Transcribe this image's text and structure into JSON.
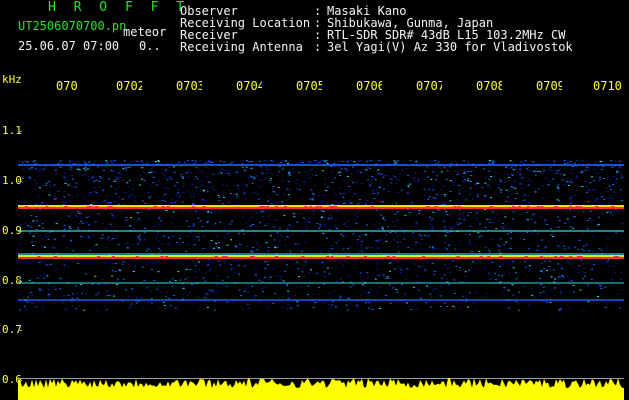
{
  "header": {
    "brand": "H R O F F T",
    "filename": "UT2506070700.pn",
    "meteor_label": "meteor",
    "datetime": "25.06.07 07:00",
    "counter": "0.."
  },
  "metadata": [
    {
      "label": "Observer",
      "value": "Masaki Kano"
    },
    {
      "label": "Receiving Location",
      "value": "Shibukawa, Gunma, Japan"
    },
    {
      "label": "Receiver",
      "value": "RTL-SDR SDR# 43dB L15 103.2MHz CW"
    },
    {
      "label": "Receiving Antenna",
      "value": "3el Yagi(V) Az 330 for Vladivostok"
    }
  ],
  "axis": {
    "y_unit": "kHz",
    "y_ticks": [
      "1.1",
      "1.0",
      "0.9",
      "0.8",
      "0.7",
      "0.6"
    ],
    "x_ticks": [
      "070",
      "0702",
      "0703",
      "0704",
      "0705",
      "0706",
      "0707",
      "0708",
      "0709",
      "0710"
    ]
  },
  "colors": {
    "background": "#000000",
    "text_green": "#27e227",
    "text_white": "#f4f4f4",
    "text_yellow": "#ffff3a",
    "noise_dark": "#0a1a8c",
    "noise_mid": "#1e64ff",
    "carrier": "#ff2a3a",
    "signal_cyan": "#34e0e0",
    "signal_yellow": "#ffff00",
    "ruler": "#9aa0a0"
  }
}
